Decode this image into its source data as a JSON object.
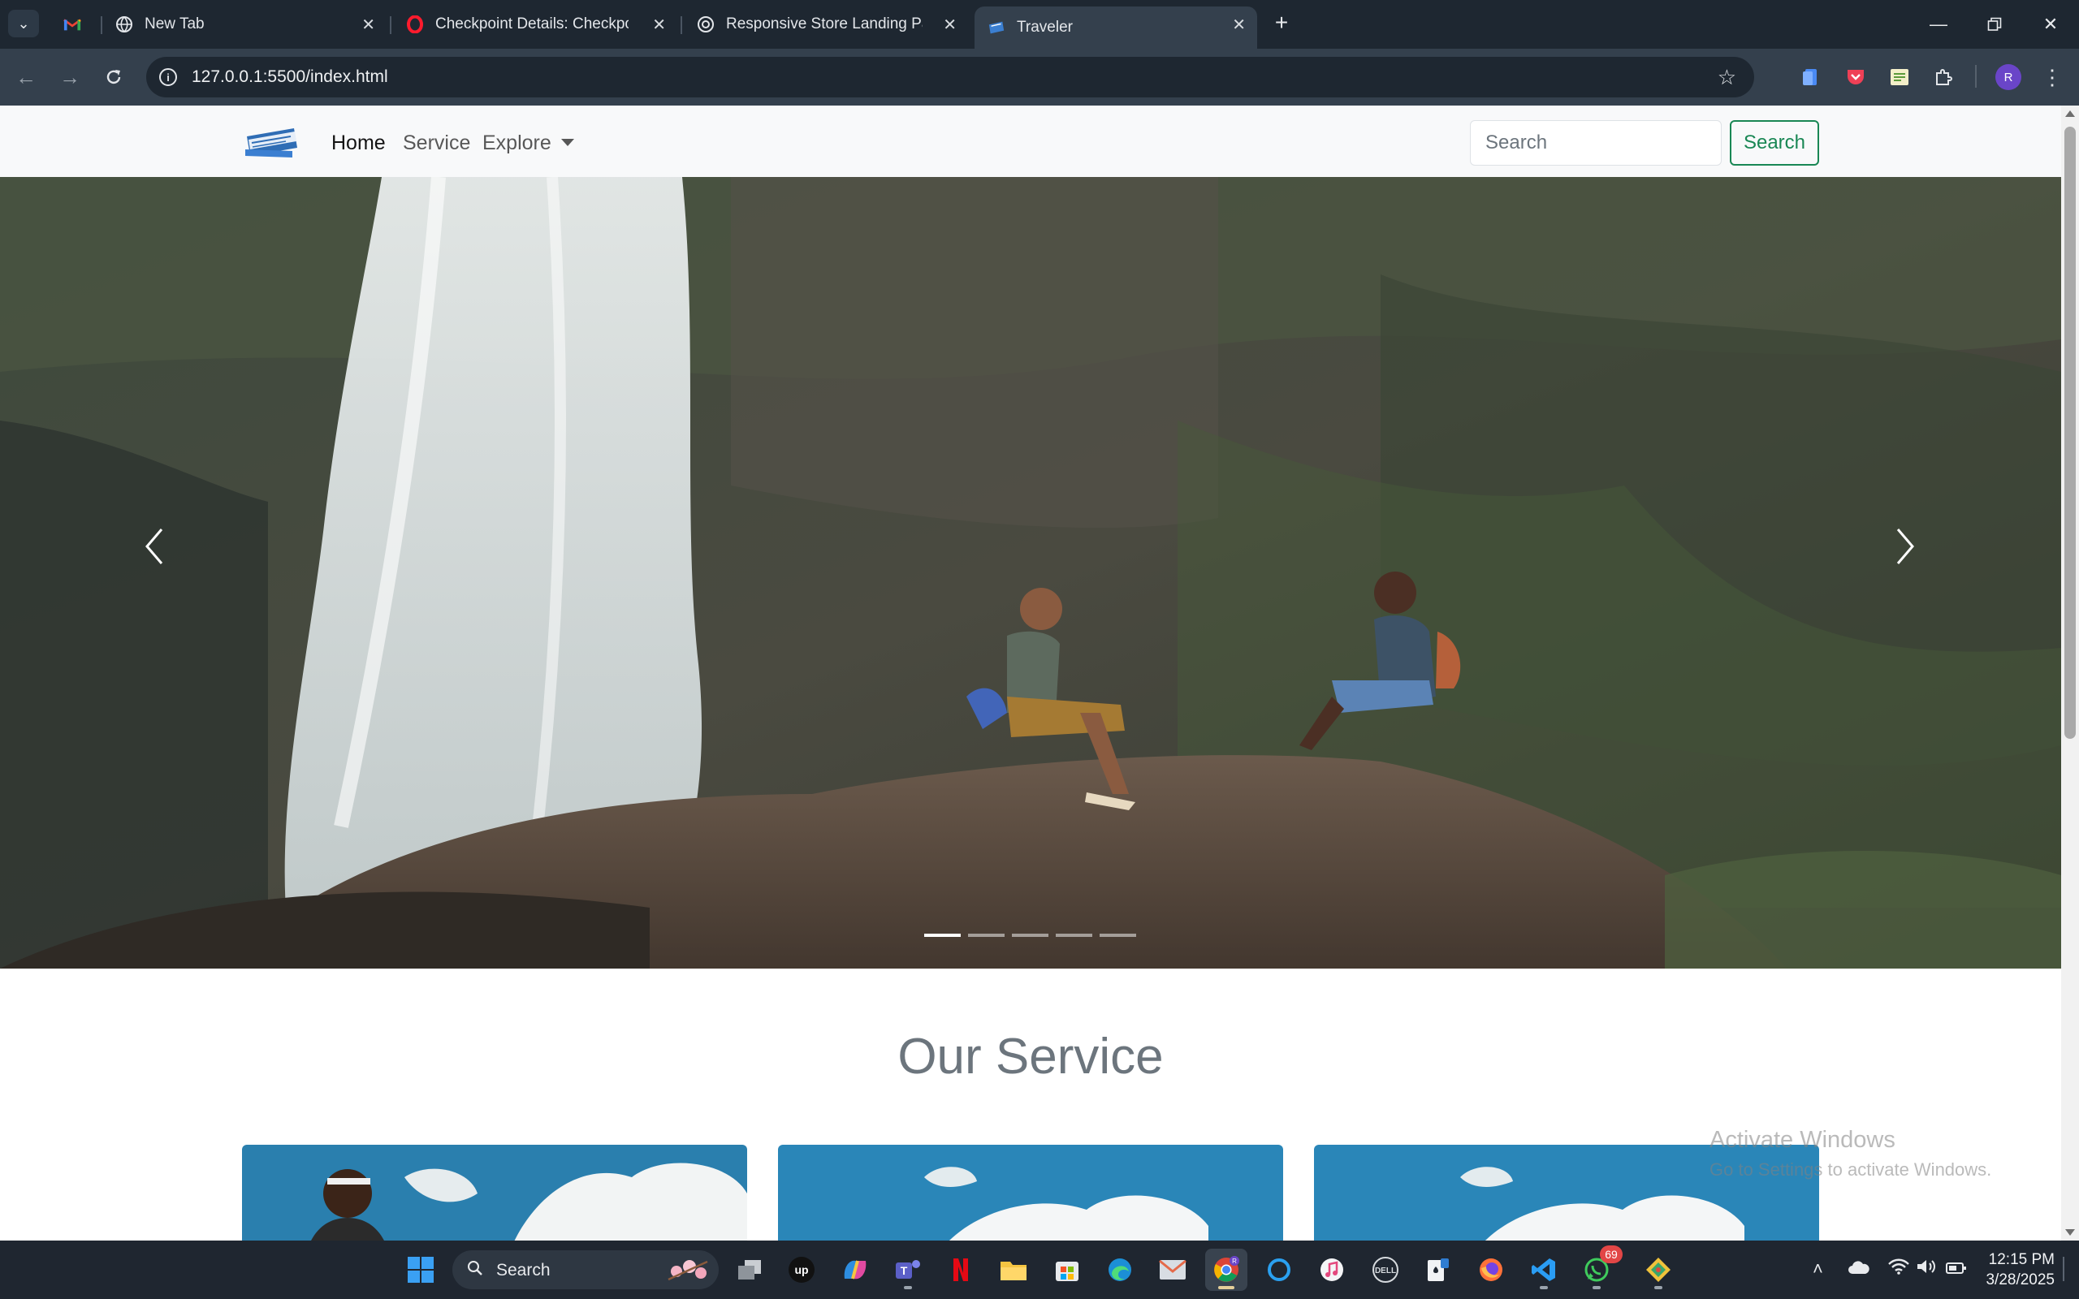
{
  "browser": {
    "tabs": [
      {
        "title": "",
        "favicon": "gmail-icon"
      },
      {
        "title": "New Tab",
        "favicon": "globe-icon"
      },
      {
        "title": "Checkpoint Details: Checkpoint",
        "favicon": "opera-icon"
      },
      {
        "title": "Responsive Store Landing Page",
        "favicon": "openai-icon"
      },
      {
        "title": "Traveler",
        "favicon": "ticket-icon",
        "active": true
      }
    ],
    "url": "127.0.0.1:5500/index.html",
    "profile_initial": "R"
  },
  "site": {
    "nav": {
      "home": "Home",
      "service": "Service",
      "explore": "Explore"
    },
    "search": {
      "placeholder": "Search",
      "button": "Search"
    },
    "carousel": {
      "slide_count": 5,
      "active_slide": 1
    },
    "section_title": "Our Service"
  },
  "watermark": {
    "title": "Activate Windows",
    "subtitle": "Go to Settings to activate Windows."
  },
  "taskbar": {
    "search_label": "Search",
    "whatsapp_badge": "69",
    "time": "12:15 PM",
    "date": "3/28/2025"
  },
  "colors": {
    "tab_bar": "#1e2731",
    "toolbar": "#34404d",
    "navbar": "#f8f9fa",
    "success": "#198754",
    "section_title": "#6c757d",
    "taskbar": "#1f2630"
  }
}
